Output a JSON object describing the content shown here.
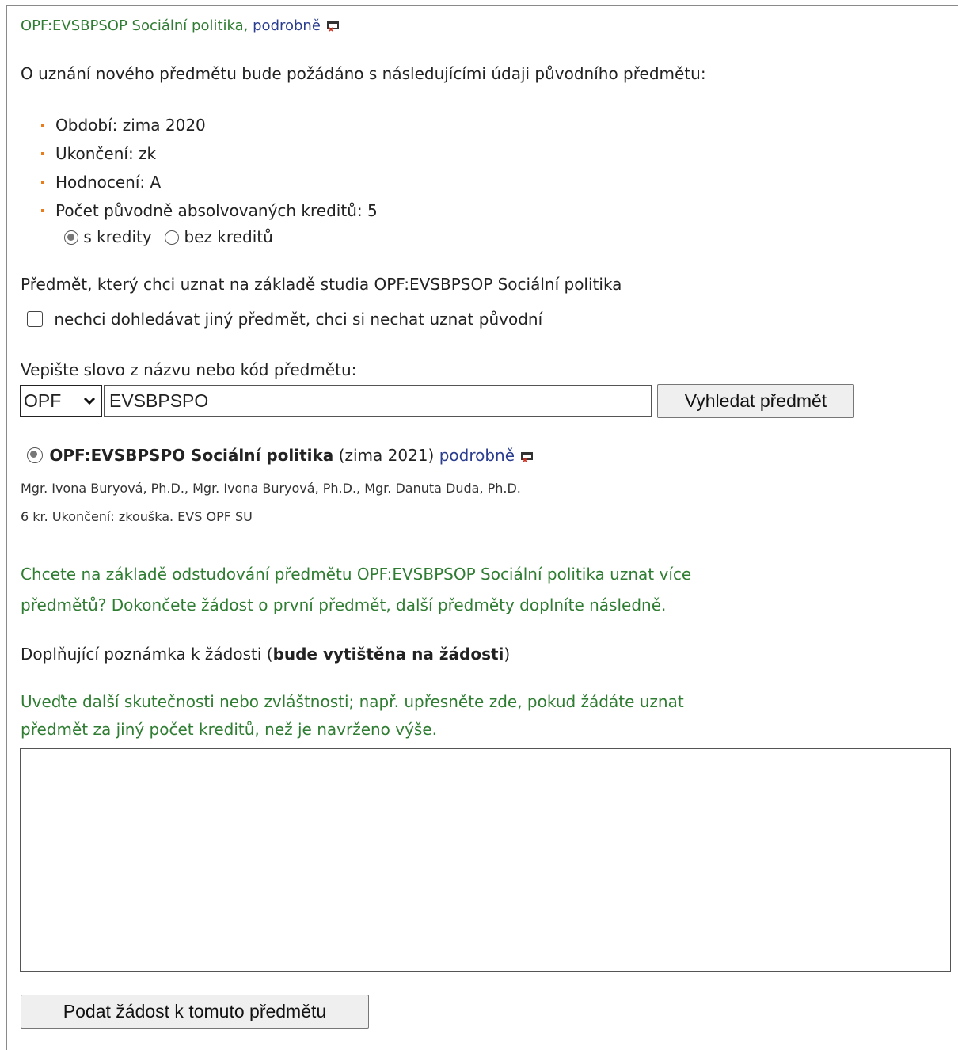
{
  "header": {
    "course_code_name": "OPF:EVSBPSOP Sociální politika,",
    "detail_link": "podrobně"
  },
  "intro": "O uznání nového předmětu bude požádáno s následujícími údaji původního předmětu:",
  "params": [
    {
      "label": "Období: zima 2020"
    },
    {
      "label": "Ukončení: zk"
    },
    {
      "label": "Hodnocení: A"
    },
    {
      "label": "Počet původně absolvovaných kreditů: 5"
    }
  ],
  "credit_options": {
    "with": "s kredity",
    "without": "bez kreditů",
    "selected": "with"
  },
  "target_label": "Předmět, který chci uznat na základě studia OPF:EVSBPSOP Sociální politika",
  "keep_original_checkbox": {
    "label": "nechci dohledávat jiný předmět, chci si nechat uznat původní",
    "checked": false
  },
  "search": {
    "label": "Vepište slovo z názvu nebo kód předmětu:",
    "faculty_select": "OPF",
    "query": "EVSBPSPO",
    "button": "Vyhledat předmět"
  },
  "result": {
    "title": "OPF:EVSBPSPO Sociální politika",
    "term": "(zima 2021)",
    "detail_link": "podrobně",
    "teachers": "Mgr. Ivona Buryová, Ph.D., Mgr. Ivona Buryová, Ph.D., Mgr. Danuta Duda, Ph.D.",
    "info": "6 kr. Ukončení: zkouška. EVS OPF SU"
  },
  "more_courses_hint": {
    "line1": "Chcete na základě odstudování předmětu OPF:EVSBPSOP Sociální politika uznat více",
    "line2": "předmětů? Dokončete žádost o první předmět, další předměty doplníte následně."
  },
  "note": {
    "label_prefix": "Doplňující poznámka k žádosti (",
    "label_bold": "bude vytištěna na žádosti",
    "label_suffix": ")",
    "hint_line1": "Uveďte další skutečnosti nebo zvláštnosti; např. upřesněte zde, pokud žádáte uznat",
    "hint_line2": "předmět za jiný počet kreditů, než je navrženo výše.",
    "value": ""
  },
  "submit_button": "Podat žádost k tomuto předmětu",
  "colors": {
    "green_text": "#2f7d32",
    "link": "#2a3d8f",
    "bullet": "#e87d1e"
  }
}
